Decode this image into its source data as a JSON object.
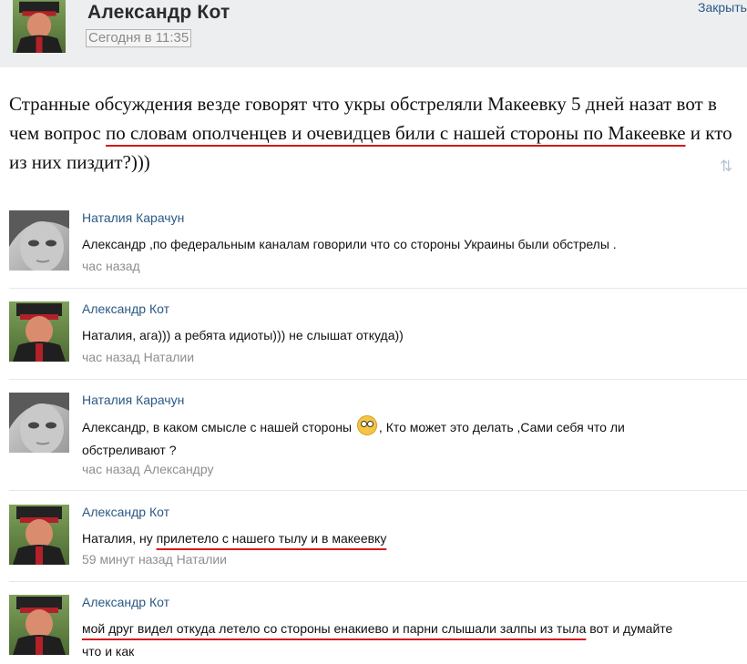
{
  "post": {
    "author": "Александр Кот",
    "time": "Сегодня в 11:35",
    "close_label": "Закрыть",
    "text_before": "Странные обсуждения везде говорят что укры обстреляли Макеевку 5 дней назат вот в чем вопрос ",
    "text_underlined": "по словам ополченцев и очевидцев били с нашей стороны по Макеевке",
    "text_after": " и кто из них пиздит?)))"
  },
  "icons": {
    "sort": "sort-arrows-icon",
    "emoji": "flushed-face-emoji-icon"
  },
  "comments": [
    {
      "author": "Наталия Карачун",
      "text": "Александр ,по федеральным каналам говорили что со стороны Украины были обстрелы .",
      "meta": "час назад"
    },
    {
      "author": "Александр Кот",
      "text": "Наталия, ага))) а ребята идиоты))) не слышат откуда))",
      "meta": "час назад Наталии"
    },
    {
      "author": "Наталия Карачун",
      "text_before_emoji": "Александр, в каком смысле с нашей стороны ",
      "text_after_emoji": ", Кто может это делать ,Сами себя что ли обстреливают ?",
      "meta": "час назад Александру"
    },
    {
      "author": "Александр Кот",
      "text_plain": "Наталия, ну ",
      "text_underlined": "прилетело с нашего тылу и в макеевку",
      "meta": "59 минут назад Наталии"
    },
    {
      "author": "Александр Кот",
      "text_underlined": "мой друг видел откуда летело со стороны енакиево и парни слышали залпы из тыла",
      "text_plain": " вот и думайте что и как"
    }
  ]
}
